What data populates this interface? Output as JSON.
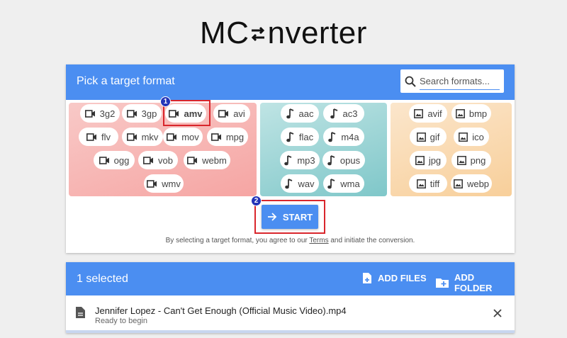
{
  "brand": {
    "prefix": "MC",
    "suffix": "nverter"
  },
  "picker": {
    "title": "Pick a target format",
    "search_placeholder": "Search formats..."
  },
  "formats": {
    "video": [
      "3g2",
      "3gp",
      "amv",
      "avi",
      "flv",
      "mkv",
      "mov",
      "mpg",
      "ogg",
      "vob",
      "webm",
      "wmv"
    ],
    "audio": [
      "aac",
      "ac3",
      "flac",
      "m4a",
      "mp3",
      "opus",
      "wav",
      "wma"
    ],
    "image": [
      "avif",
      "bmp",
      "gif",
      "ico",
      "jpg",
      "png",
      "tiff",
      "webp"
    ]
  },
  "selected_format": "amv",
  "annotations": {
    "step1": "1",
    "step2": "2"
  },
  "start_label": "START",
  "terms": {
    "before": "By selecting a target format, you agree to our",
    "link": "Terms",
    "after": "and initiate the conversion."
  },
  "files_panel": {
    "selected_count": "1 selected",
    "add_files_label": "ADD FILES",
    "add_folder_label": "ADD FOLDER",
    "file_name": "Jennifer Lopez - Can't Get Enough (Official Music Video).mp4",
    "file_status": "Ready to begin"
  },
  "colors": {
    "accent": "#4b8ef1",
    "highlight": "#d9262c",
    "badge": "#2434b8"
  },
  "icons": {
    "video": "video-camera-icon",
    "audio": "music-note-icon",
    "image": "image-icon"
  }
}
